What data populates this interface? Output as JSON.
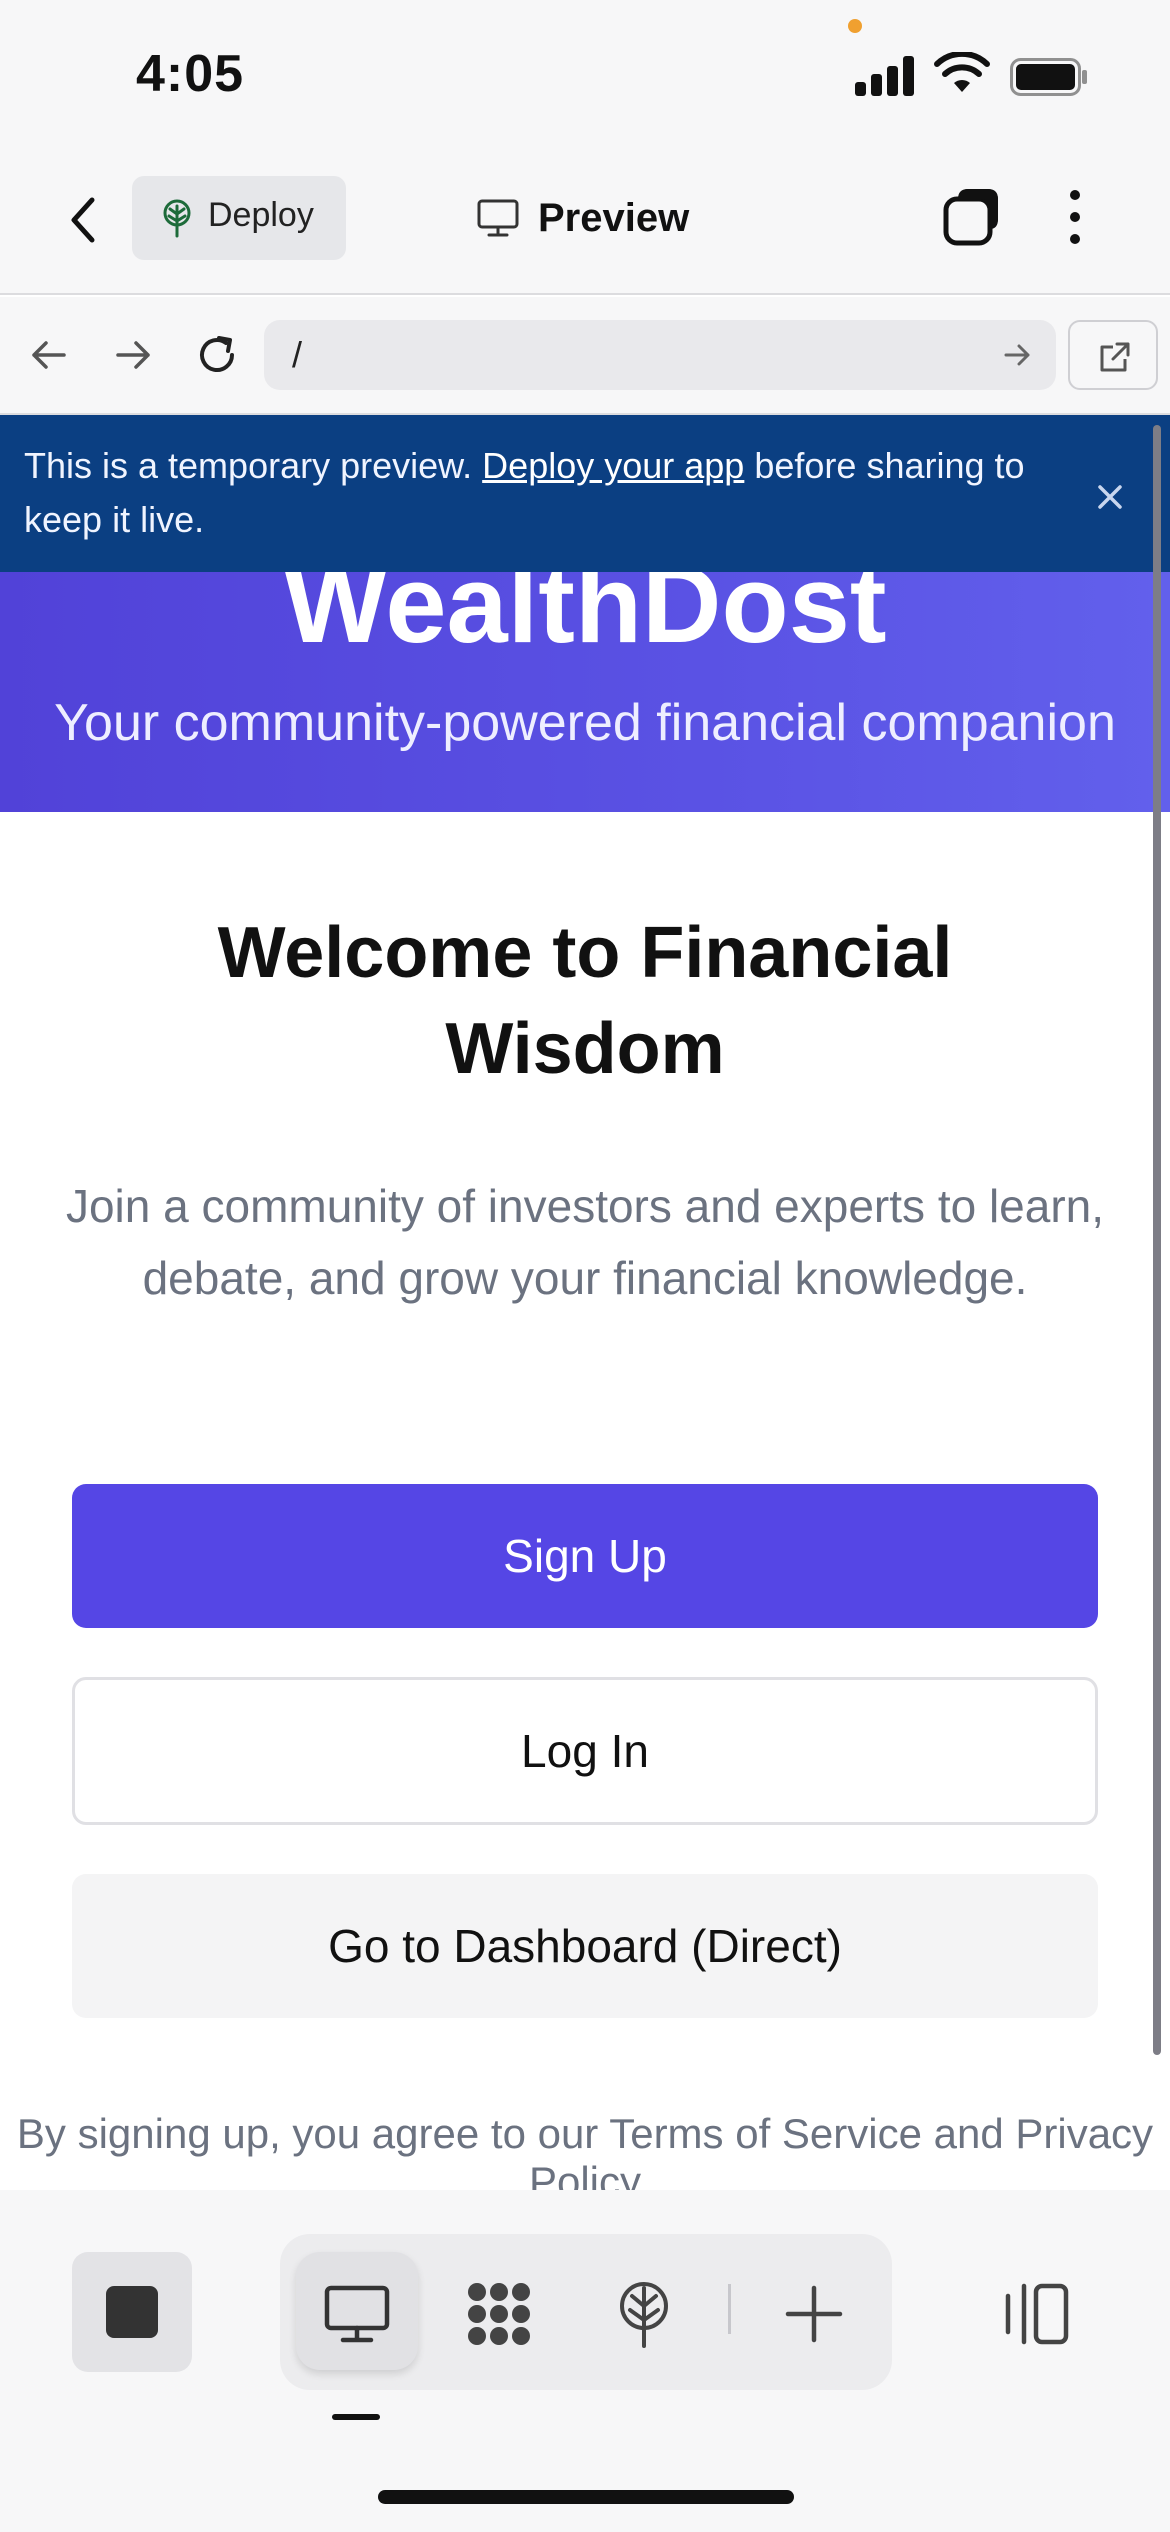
{
  "status_bar": {
    "time": "4:05"
  },
  "header": {
    "deploy_label": "Deploy",
    "title": "Preview"
  },
  "url_bar": {
    "path": "/"
  },
  "banner": {
    "text_before": "This is a temporary preview.",
    "link_text": "Deploy your app",
    "text_after": "before sharing to keep it live."
  },
  "hero": {
    "title": "WealthDost",
    "subtitle": "Your community-powered financial companion"
  },
  "main": {
    "heading": "Welcome to Financial Wisdom",
    "intro": "Join a community of investors and experts to learn, debate, and grow your financial knowledge.",
    "signup_label": "Sign Up",
    "login_label": "Log In",
    "dashboard_label": "Go to Dashboard (Direct)",
    "terms": "By signing up, you agree to our Terms of Service and Privacy Policy"
  },
  "colors": {
    "primary": "#5546e5",
    "banner": "#0b3f82",
    "hero_gradient_start": "#5142d8",
    "hero_gradient_end": "#6260ec"
  },
  "icons": {
    "deploy": "deploy-tree-icon",
    "preview": "monitor-icon",
    "tabs": "tabs-icon",
    "more": "more-vertical-icon",
    "back": "chevron-left-icon",
    "nav_back": "arrow-left-icon",
    "nav_forward": "arrow-right-icon",
    "reload": "reload-icon",
    "open_external": "external-link-icon",
    "close": "close-icon",
    "stop": "stop-icon",
    "workspace": "workspace-icon",
    "add": "plus-icon",
    "layout": "layout-toggle-icon"
  }
}
